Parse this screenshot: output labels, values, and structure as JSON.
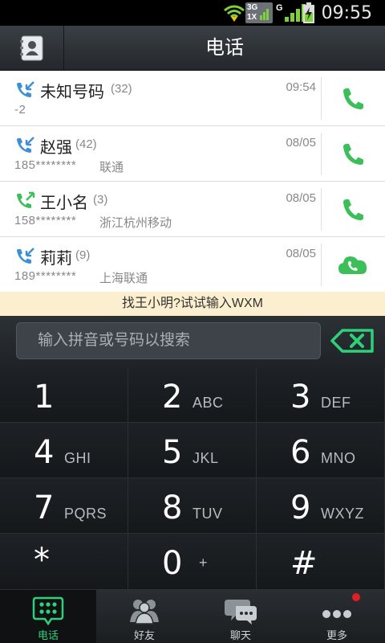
{
  "status_bar": {
    "time": "09:55",
    "network_top": "3G",
    "network_bottom": "1X",
    "network_g": "G"
  },
  "header": {
    "title": "电话"
  },
  "call_log": [
    {
      "name": "未知号码",
      "count": "(32)",
      "number": "-2",
      "location": "",
      "time": "09:54",
      "type": "missed",
      "action": "phone"
    },
    {
      "name": "赵强",
      "count": "(42)",
      "number": "185********",
      "location": "联通",
      "time": "08/05",
      "type": "missed",
      "action": "phone"
    },
    {
      "name": "王小名",
      "count": "(3)",
      "number": "158********",
      "location": "浙江杭州移动",
      "time": "08/05",
      "type": "outgoing",
      "action": "phone"
    },
    {
      "name": "莉莉",
      "count": "(9)",
      "number": "189********",
      "location": "上海联通",
      "time": "08/05",
      "type": "missed",
      "action": "cloud-call"
    }
  ],
  "hint": "找王小明?试试输入WXM",
  "search": {
    "placeholder": "输入拼音或号码以搜索"
  },
  "keypad": [
    {
      "digit": "1",
      "letters": ""
    },
    {
      "digit": "2",
      "letters": "ABC"
    },
    {
      "digit": "3",
      "letters": "DEF"
    },
    {
      "digit": "4",
      "letters": "GHI"
    },
    {
      "digit": "5",
      "letters": "JKL"
    },
    {
      "digit": "6",
      "letters": "MNO"
    },
    {
      "digit": "7",
      "letters": "PQRS"
    },
    {
      "digit": "8",
      "letters": "TUV"
    },
    {
      "digit": "9",
      "letters": "WXYZ"
    },
    {
      "digit": "*",
      "letters": ""
    },
    {
      "digit": "0",
      "letters": "+"
    },
    {
      "digit": "#",
      "letters": ""
    }
  ],
  "nav": [
    {
      "label": "电话",
      "icon": "dialpad-icon",
      "active": true
    },
    {
      "label": "好友",
      "icon": "friends-icon",
      "active": false
    },
    {
      "label": "聊天",
      "icon": "chat-icon",
      "active": false
    },
    {
      "label": "更多",
      "icon": "more-icon",
      "active": false,
      "badge": true
    }
  ],
  "colors": {
    "accent_green": "#2fd07a",
    "call_green": "#3cbf58",
    "missed_blue": "#3d8fd6",
    "hint_bg": "#fcefcf"
  }
}
